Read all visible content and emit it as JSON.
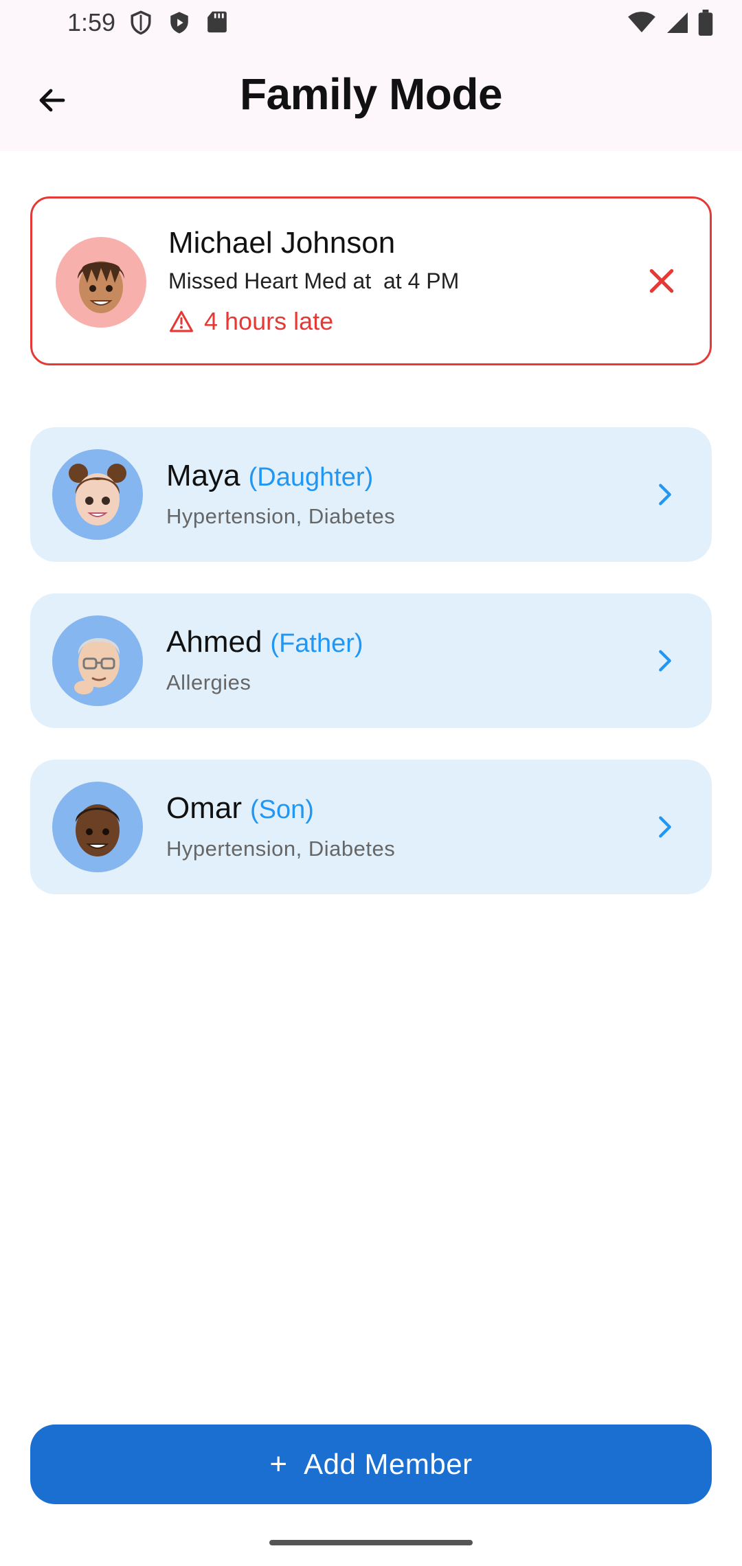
{
  "status_bar": {
    "time": "1:59",
    "left_icons": [
      "shield-outline-icon",
      "play-shield-icon",
      "sd-card-icon"
    ],
    "right_icons": [
      "wifi-icon",
      "signal-icon",
      "battery-icon"
    ]
  },
  "app_bar": {
    "back_icon": "arrow-left-icon",
    "title": "Family Mode"
  },
  "alert": {
    "name": "Michael Johnson",
    "message": "Missed Heart Med at  at 4 PM",
    "late_text": "4 hours late",
    "warning_icon": "warning-triangle-icon",
    "dismiss_icon": "close-icon",
    "accent": "#e53935"
  },
  "members": [
    {
      "name": "Maya",
      "relation": "(Daughter)",
      "conditions": "Hypertension, Diabetes",
      "avatar": "girl-memoji"
    },
    {
      "name": "Ahmed",
      "relation": "(Father)",
      "conditions": "Allergies",
      "avatar": "grandpa-memoji"
    },
    {
      "name": "Omar",
      "relation": "(Son)",
      "conditions": "Hypertension, Diabetes",
      "avatar": "boy-memoji"
    }
  ],
  "add_button": {
    "plus": "+",
    "label": "Add Member",
    "color": "#1a6fd1"
  }
}
